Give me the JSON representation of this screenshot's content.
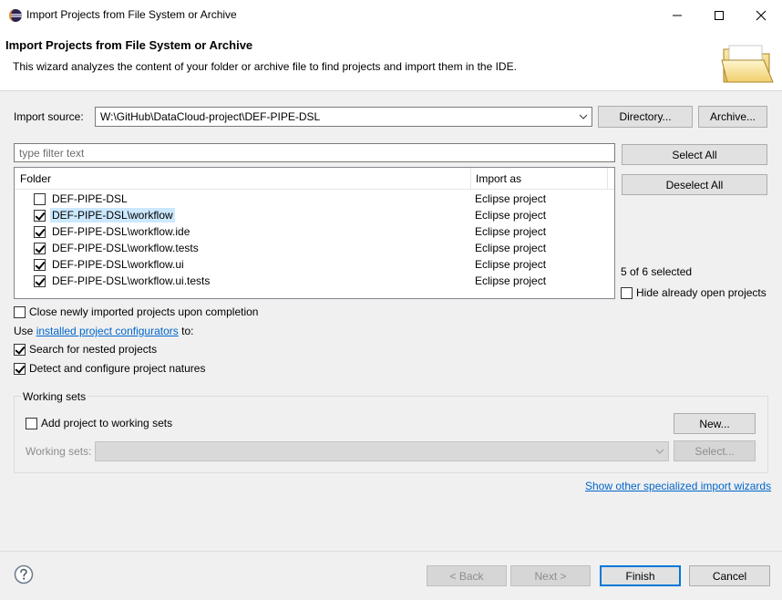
{
  "window": {
    "title": "Import Projects from File System or Archive",
    "minimize_icon": "minimize-icon",
    "maximize_icon": "maximize-icon",
    "close_icon": "close-icon"
  },
  "header": {
    "title": "Import Projects from File System or Archive",
    "description": "This wizard analyzes the content of your folder or archive file to find projects and import them in the IDE."
  },
  "import_source": {
    "label": "Import source:",
    "value": "W:\\GitHub\\DataCloud-project\\DEF-PIPE-DSL",
    "directory_button": "Directory...",
    "archive_button": "Archive..."
  },
  "filter": {
    "placeholder": "type filter text"
  },
  "table": {
    "columns": [
      "Folder",
      "Import as"
    ],
    "rows": [
      {
        "folder": "DEF-PIPE-DSL",
        "import_as": "Eclipse project",
        "checked": false
      },
      {
        "folder": "DEF-PIPE-DSL\\workflow",
        "import_as": "Eclipse project",
        "checked": true,
        "selected": true
      },
      {
        "folder": "DEF-PIPE-DSL\\workflow.ide",
        "import_as": "Eclipse project",
        "checked": true
      },
      {
        "folder": "DEF-PIPE-DSL\\workflow.tests",
        "import_as": "Eclipse project",
        "checked": true
      },
      {
        "folder": "DEF-PIPE-DSL\\workflow.ui",
        "import_as": "Eclipse project",
        "checked": true
      },
      {
        "folder": "DEF-PIPE-DSL\\workflow.ui.tests",
        "import_as": "Eclipse project",
        "checked": true
      }
    ]
  },
  "side": {
    "select_all": "Select All",
    "deselect_all": "Deselect All",
    "selected_count": "5 of 6 selected",
    "hide_open": "Hide already open projects",
    "hide_open_checked": false
  },
  "options": {
    "close_after": "Close newly imported projects upon completion",
    "close_after_checked": false,
    "use_prefix": "Use ",
    "configurators_link": "installed project configurators",
    "use_suffix": " to:",
    "search_nested": "Search for nested projects",
    "search_nested_checked": true,
    "detect_natures": "Detect and configure project natures",
    "detect_natures_checked": true
  },
  "working_sets": {
    "title": "Working sets",
    "add_label": "Add project to working sets",
    "add_checked": false,
    "new_button": "New...",
    "sets_label": "Working sets:",
    "sets_value": "",
    "select_button": "Select..."
  },
  "wizards_link": "Show other specialized import wizards",
  "footer": {
    "back": "< Back",
    "next": "Next >",
    "finish": "Finish",
    "cancel": "Cancel"
  },
  "colors": {
    "link": "#0066cc",
    "selection": "#cce8ff",
    "default_button_border": "#0078d7"
  }
}
